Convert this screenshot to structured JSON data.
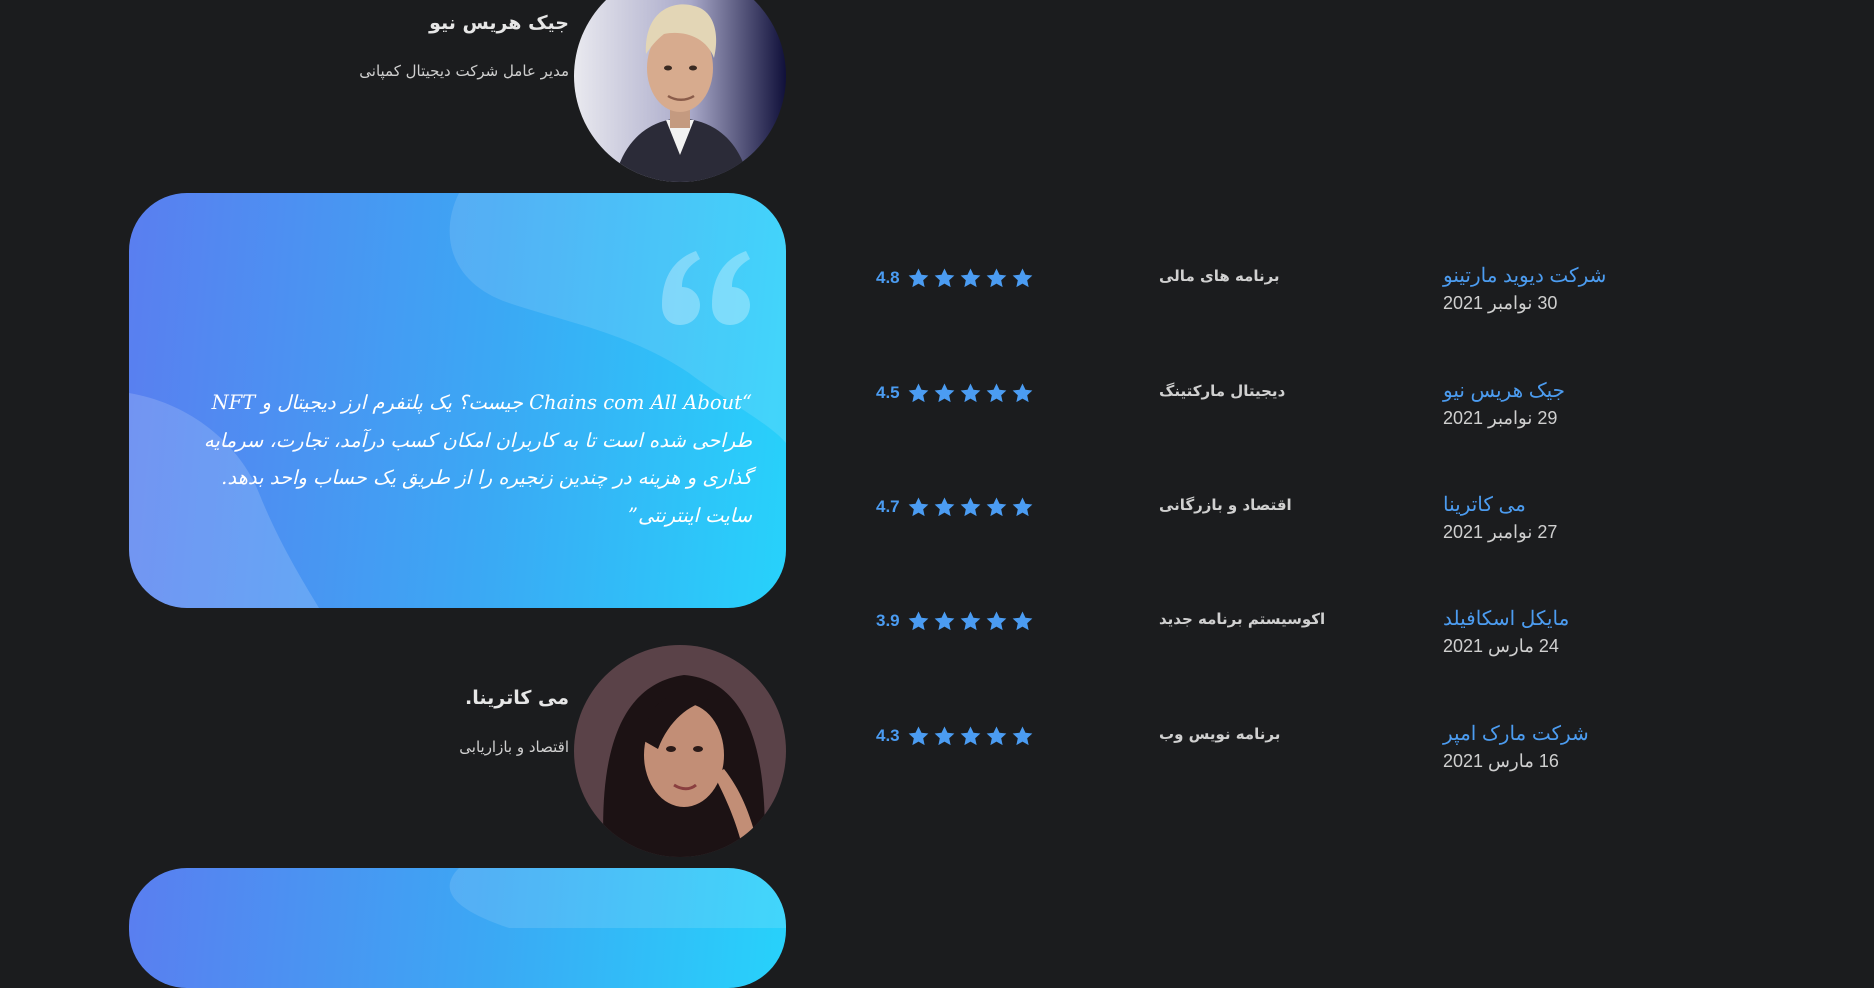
{
  "testimonials": [
    {
      "name": "جیک هریس نیو",
      "role": "مدیر عامل شرکت دیجیتال کمپانی"
    },
    {
      "name": "می کاترینا.",
      "role": "اقتصاد و بازاریابی"
    }
  ],
  "quote": {
    "text": "“Chains com All About جیست؟ یک پلتفرم ارز دیجیتال و NFT طراحی شده است تا به کاربران امکان کسب درآمد، تجارت، سرمایه گذاری و هزینه در چندین زنجیره را از طریق یک حساب واحد بدهد. سایت اینترنتی”"
  },
  "colors": {
    "accent": "#4b9cf2",
    "background": "#1b1c1e",
    "card_gradient": [
      "#5a7ef0",
      "#27d2fb"
    ]
  },
  "icons": {
    "rating": "star-icon",
    "quote": "quote-icon"
  },
  "list": [
    {
      "org": "شرکت دیوید مارتینو",
      "date": "30 نوامبر 2021",
      "category": "برنامه های مالی",
      "rating": "4.8",
      "stars": 5
    },
    {
      "org": "جیک هریس نیو",
      "date": "29 نوامبر 2021",
      "category": "دیجیتال مارکتینگ",
      "rating": "4.5",
      "stars": 5
    },
    {
      "org": "می کاترینا",
      "date": "27 نوامبر 2021",
      "category": "اقتصاد و بازرگانی",
      "rating": "4.7",
      "stars": 5
    },
    {
      "org": "مایکل اسکافیلد",
      "date": "24 مارس 2021",
      "category": "اکوسیستم برنامه جدید",
      "rating": "3.9",
      "stars": 5
    },
    {
      "org": "شرکت مارک امپر",
      "date": "16 مارس 2021",
      "category": "برنامه نویس وب",
      "rating": "4.3",
      "stars": 5
    }
  ]
}
